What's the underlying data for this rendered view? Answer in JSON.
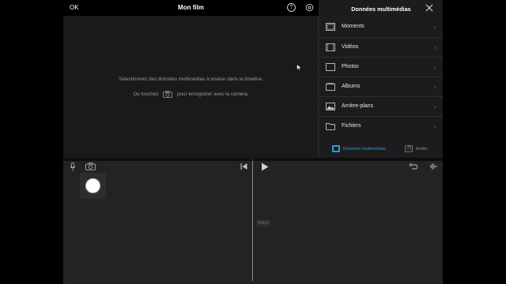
{
  "header": {
    "ok_label": "OK",
    "title": "Mon film",
    "help_label": "?"
  },
  "viewer": {
    "message_line1": "Sélectionnez des données multimédias à insérer dans la timeline.",
    "message_line2_prefix": "Ou touchez",
    "message_line2_suffix": "pour enregistrer avec la caméra."
  },
  "media_panel": {
    "title": "Données multimédias",
    "items": [
      {
        "label": "Moments",
        "icon": "moments-icon"
      },
      {
        "label": "Vidéos",
        "icon": "film-icon"
      },
      {
        "label": "Photos",
        "icon": "photo-icon"
      },
      {
        "label": "Albums",
        "icon": "albums-icon"
      },
      {
        "label": "Arrière-plans",
        "icon": "background-icon"
      },
      {
        "label": "Fichiers",
        "icon": "folder-icon"
      }
    ],
    "tabs": [
      {
        "label": "Données multimédias",
        "selected": true
      },
      {
        "label": "Audio",
        "selected": false
      }
    ]
  },
  "timeline": {
    "marker_label": "0:00.0"
  },
  "colors": {
    "accent": "#2d9cdb",
    "background": "#1e1e1e"
  }
}
